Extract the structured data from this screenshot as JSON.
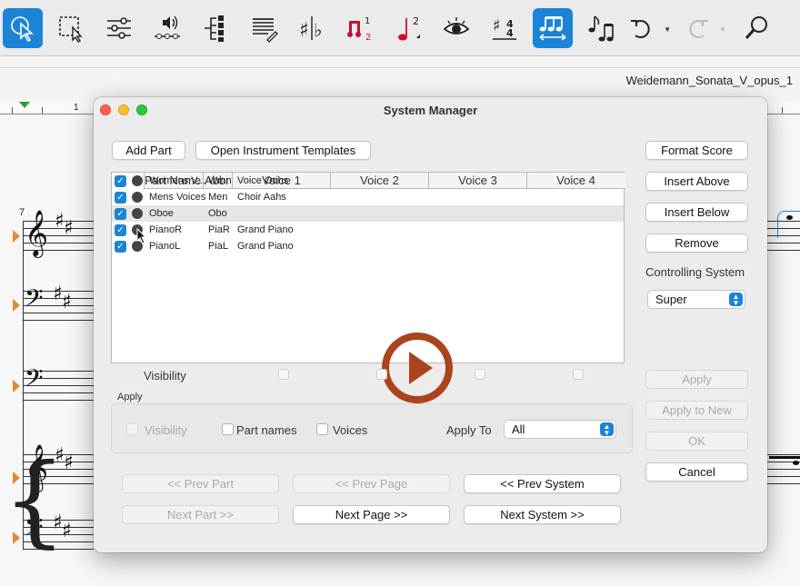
{
  "window": {
    "document_title": "Weidemann_Sonata_V_opus_1"
  },
  "toolbar": {
    "tools": [
      {
        "icon": "selection-arrow-icon",
        "active": true
      },
      {
        "icon": "marquee-select-icon",
        "active": false
      },
      {
        "icon": "mixer-sliders-icon",
        "active": false
      },
      {
        "icon": "speaker-icon",
        "active": false
      },
      {
        "icon": "hierarchy-icon",
        "active": false
      },
      {
        "icon": "page-text-icon",
        "active": false
      },
      {
        "icon": "accidentals-icon",
        "active": false
      },
      {
        "icon": "tuplet-numbers-icon",
        "active": false
      },
      {
        "icon": "note-superscript-icon",
        "active": false
      },
      {
        "icon": "eye-icon",
        "active": false
      },
      {
        "icon": "key-time-icon",
        "active": false
      },
      {
        "icon": "beam-notes-icon",
        "active": true
      },
      {
        "icon": "note-entry-icon",
        "active": false
      },
      {
        "icon": "undo-icon",
        "active": false
      },
      {
        "icon": "redo-icon",
        "active": false
      },
      {
        "icon": "search-icon",
        "active": false
      }
    ]
  },
  "ruler": {
    "marker": "1"
  },
  "score": {
    "measure_number": "7"
  },
  "dialog": {
    "title": "System Manager",
    "add_part": "Add Part",
    "open_templates": "Open Instrument Templates",
    "table": {
      "headers": [
        "Part Name",
        "Abbr",
        "Voice 1",
        "Voice 2",
        "Voice 3",
        "Voice 4"
      ],
      "rows": [
        {
          "name": "Womens V...",
          "abbr": "Wmn",
          "voice1": "Voice Oohs",
          "selected": false
        },
        {
          "name": "Mens Voices",
          "abbr": "Men",
          "voice1": "Choir Aahs",
          "selected": false
        },
        {
          "name": "Oboe",
          "abbr": "Obo",
          "voice1": "",
          "selected": true
        },
        {
          "name": "PianoR",
          "abbr": "PiaR",
          "voice1": "Grand Piano",
          "selected": false
        },
        {
          "name": "PianoL",
          "abbr": "PiaL",
          "voice1": "Grand Piano",
          "selected": false
        }
      ]
    },
    "visibility_label": "Visibility",
    "apply_group": {
      "title": "Apply",
      "visibility": "Visibility",
      "part_names": "Part names",
      "voices": "Voices",
      "apply_to_label": "Apply To",
      "apply_to_value": "All"
    },
    "nav": {
      "prev_part": "<< Prev Part",
      "prev_page": "<< Prev Page",
      "prev_system": "<< Prev System",
      "next_part": "Next Part >>",
      "next_page": "Next Page >>",
      "next_system": "Next System >>"
    },
    "side": {
      "format_score": "Format Score",
      "insert_above": "Insert Above",
      "insert_below": "Insert Below",
      "remove": "Remove",
      "controlling_system_label": "Controlling System",
      "controlling_system_value": "Super",
      "apply": "Apply",
      "apply_to_new": "Apply to New",
      "ok": "OK",
      "cancel": "Cancel"
    },
    "colors": {
      "accent": "#1c84d6",
      "play": "#a9441c"
    }
  }
}
